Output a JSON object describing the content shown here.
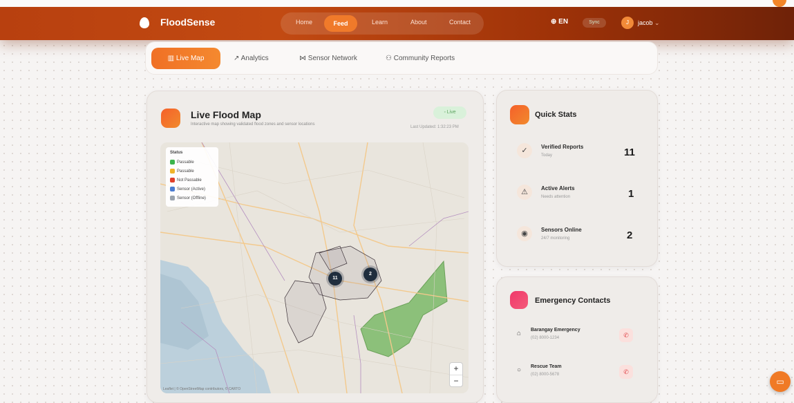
{
  "brand": {
    "name": "FloodSense"
  },
  "nav": {
    "items": [
      "Home",
      "Feed",
      "Learn",
      "About",
      "Contact"
    ],
    "active": "Feed"
  },
  "header": {
    "language": "EN",
    "sync": "Sync",
    "avatar_initial": "J",
    "username": "jacob"
  },
  "tabs": [
    {
      "label": "Live Map",
      "icon": "map-icon"
    },
    {
      "label": "Analytics",
      "icon": "trend-icon"
    },
    {
      "label": "Sensor Network",
      "icon": "network-icon"
    },
    {
      "label": "Community Reports",
      "icon": "users-icon"
    }
  ],
  "map_card": {
    "title": "Live Flood Map",
    "subtitle": "Interactive map showing validated flood zones and sensor locations",
    "live": "Live",
    "last_updated": "Last Updated: 1:32:23 PM",
    "legend": {
      "title": "Status",
      "items": [
        {
          "label": "Passable",
          "color": "#3cb44b"
        },
        {
          "label": "Passable",
          "color": "#f0b429"
        },
        {
          "label": "Not Passable",
          "color": "#e0402a"
        },
        {
          "label": "Sensor (Active)",
          "color": "#4a7bd0"
        },
        {
          "label": "Sensor (Offline)",
          "color": "#9aa3ad"
        }
      ]
    },
    "clusters": [
      "11",
      "2"
    ],
    "attribution": "Leaflet | © OpenStreetMap contributors, © CARTO"
  },
  "quick_stats": {
    "title": "Quick Stats",
    "items": [
      {
        "label": "Verified Reports",
        "sub": "Today",
        "value": "11",
        "icon": "check-icon"
      },
      {
        "label": "Active Alerts",
        "sub": "Needs attention",
        "value": "1",
        "icon": "warning-icon"
      },
      {
        "label": "Sensors Online",
        "sub": "24/7 monitoring",
        "value": "2",
        "icon": "sensor-icon"
      }
    ]
  },
  "emergency": {
    "title": "Emergency Contacts",
    "items": [
      {
        "name": "Barangay Emergency",
        "phone": "(02) 8000-1234"
      },
      {
        "name": "Rescue Team",
        "phone": "(02) 8000-5678"
      }
    ]
  },
  "colors": {
    "accent": "#f07025",
    "header": "#b8400f"
  }
}
